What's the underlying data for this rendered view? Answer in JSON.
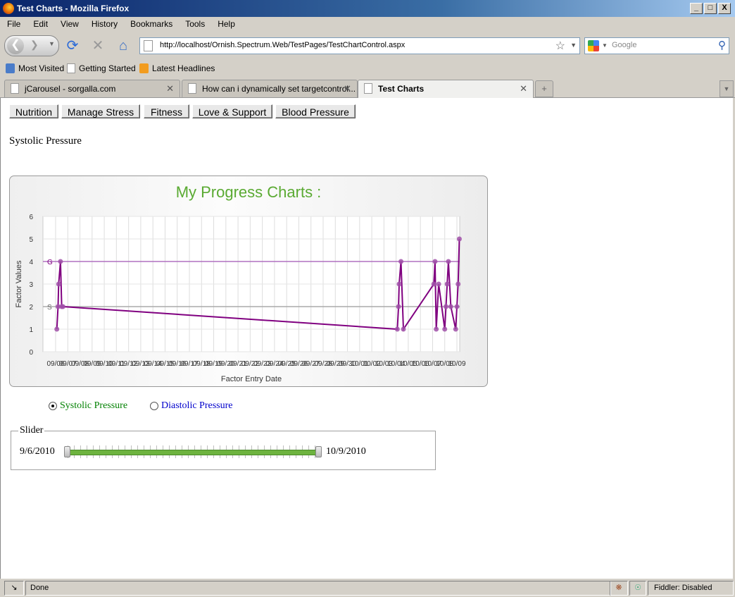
{
  "window": {
    "title": "Test Charts - Mozilla Firefox",
    "min": "_",
    "max": "□",
    "close": "X"
  },
  "menu": [
    "File",
    "Edit",
    "View",
    "History",
    "Bookmarks",
    "Tools",
    "Help"
  ],
  "nav": {
    "url": "http://localhost/Ornish.Spectrum.Web/TestPages/TestChartControl.aspx",
    "search_placeholder": "Google"
  },
  "bookmarks": [
    "Most Visited",
    "Getting Started",
    "Latest Headlines"
  ],
  "tabs": [
    {
      "label": "jCarousel - sorgalla.com",
      "active": false
    },
    {
      "label": "How can i dynamically set targetcontrol...",
      "active": false
    },
    {
      "label": "Test Charts",
      "active": true
    }
  ],
  "page": {
    "buttons": [
      "Nutrition",
      "Manage Stress",
      "Fitness",
      "Love & Support",
      "Blood Pressure"
    ],
    "heading": "Systolic Pressure",
    "radios": [
      {
        "label": "Systolic Pressure",
        "checked": true,
        "color": "#008000"
      },
      {
        "label": "Diastolic Pressure",
        "checked": false,
        "color": "#0000cc"
      }
    ],
    "slider": {
      "legend": "Slider",
      "from": "9/6/2010",
      "to": "10/9/2010",
      "fill_color": "#6db33f"
    }
  },
  "chart_data": {
    "type": "line",
    "title": "My Progress Charts :",
    "xlabel": "Factor Entry Date",
    "ylabel": "Factor Values",
    "ylim": [
      0,
      6
    ],
    "yticks": [
      "0",
      "1",
      "2",
      "3",
      "4",
      "5",
      "6"
    ],
    "xticks": [
      "09/06",
      "09/07",
      "09/08",
      "09/09",
      "09/10",
      "09/11",
      "09/12",
      "09/13",
      "09/14",
      "09/15",
      "09/16",
      "09/17",
      "09/18",
      "09/19",
      "09/20",
      "09/21",
      "09/22",
      "09/23",
      "09/24",
      "09/25",
      "09/26",
      "09/27",
      "09/28",
      "09/29",
      "09/30",
      "10/01",
      "10/02",
      "10/03",
      "10/04",
      "10/05",
      "10/06",
      "10/07",
      "10/08",
      "10/09"
    ],
    "grid": true,
    "title_color": "#5aaa32",
    "line_color": "#800080",
    "goal_line": {
      "label": "G",
      "value": 4,
      "color": "#b070c0"
    },
    "start_line": {
      "label": "S",
      "value": 2,
      "color": "#aaaaaa"
    },
    "series": [
      {
        "x": [
          0.1,
          0.2,
          0.25,
          0.4,
          0.5,
          0.6,
          28.1,
          28.2,
          28.25,
          28.4,
          28.6,
          31.1,
          31.2,
          31.3,
          31.5,
          32.0,
          32.1,
          32.2,
          32.3,
          32.5,
          32.9,
          33.0,
          33.1,
          33.2
        ],
        "y": [
          1,
          2,
          3,
          4,
          2,
          2,
          1,
          2,
          3,
          4,
          1,
          3,
          4,
          1,
          3,
          1,
          2,
          3,
          4,
          2,
          1,
          2,
          3,
          5
        ]
      }
    ]
  },
  "status": {
    "text": "Done",
    "fiddler": "Fiddler: Disabled"
  }
}
